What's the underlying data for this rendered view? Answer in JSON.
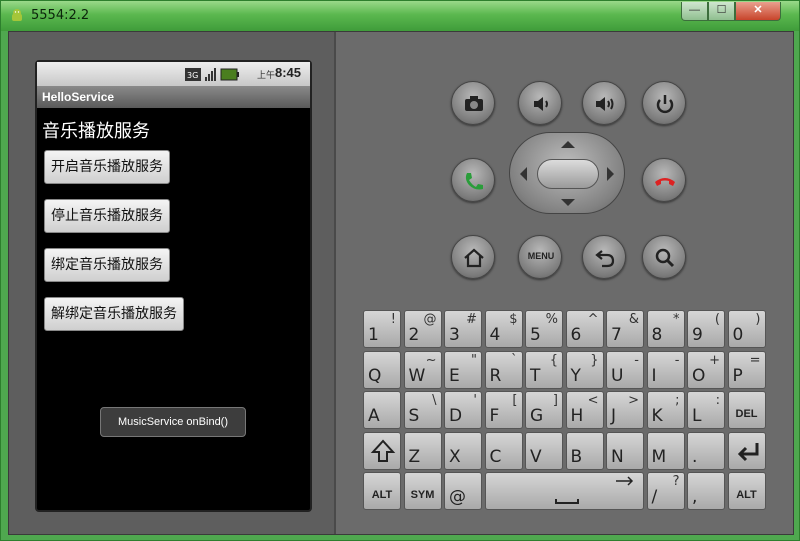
{
  "window": {
    "title": "5554:2.2"
  },
  "status": {
    "ampm": "上午",
    "time": "8:45"
  },
  "app": {
    "title": "HelloService",
    "heading": "音乐播放服务",
    "buttons": [
      "开启音乐播放服务",
      "停止音乐播放服务",
      "绑定音乐播放服务",
      "解绑定音乐播放服务"
    ],
    "toast": "MusicService onBind()"
  },
  "controls": {
    "menu_label": "MENU",
    "icons": [
      "camera-icon",
      "volume-down-icon",
      "volume-up-icon",
      "power-icon",
      "call-icon",
      "end-call-icon",
      "home-icon",
      "menu-icon",
      "back-icon",
      "search-icon"
    ]
  },
  "keyboard": {
    "row1": [
      [
        "1",
        "!"
      ],
      [
        "2",
        "@"
      ],
      [
        "3",
        "#"
      ],
      [
        "4",
        "$"
      ],
      [
        "5",
        "%"
      ],
      [
        "6",
        "^"
      ],
      [
        "7",
        "&"
      ],
      [
        "8",
        "*"
      ],
      [
        "9",
        "("
      ],
      [
        "0",
        ")"
      ]
    ],
    "row2": [
      [
        "Q",
        ""
      ],
      [
        "W",
        "~"
      ],
      [
        "E",
        "\""
      ],
      [
        "R",
        "`"
      ],
      [
        "T",
        "{"
      ],
      [
        "Y",
        "}"
      ],
      [
        "U",
        "-"
      ],
      [
        "I",
        "-"
      ],
      [
        "O",
        "+"
      ],
      [
        "P",
        "="
      ]
    ],
    "row3": [
      [
        "A",
        ""
      ],
      [
        "S",
        "\\"
      ],
      [
        "D",
        "'"
      ],
      [
        "F",
        "["
      ],
      [
        "G",
        "]"
      ],
      [
        "H",
        "<"
      ],
      [
        "J",
        ">"
      ],
      [
        "K",
        ";"
      ],
      [
        "L",
        ":"
      ]
    ],
    "row4": [
      [
        "Z",
        ""
      ],
      [
        "X",
        ""
      ],
      [
        "C",
        ""
      ],
      [
        "V",
        ""
      ],
      [
        "B",
        ""
      ],
      [
        "N",
        ""
      ],
      [
        "M",
        ""
      ],
      [
        ".",
        ""
      ]
    ],
    "labels": {
      "del": "DEL",
      "alt": "ALT",
      "sym": "SYM",
      "at": "@",
      "slash": "/",
      "question": "?",
      "comma": ","
    }
  }
}
